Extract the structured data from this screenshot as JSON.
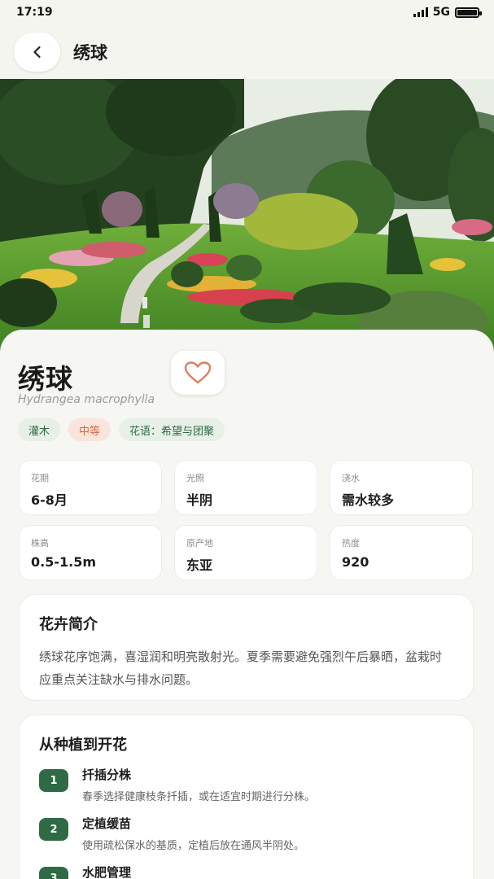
{
  "status_bar": {
    "time": "17:19",
    "network": "5G"
  },
  "nav": {
    "title": "绣球"
  },
  "plant": {
    "name": "绣球",
    "latin": "Hydrangea macrophylla",
    "tags": [
      {
        "label": "灌木",
        "style": "green"
      },
      {
        "label": "中等",
        "style": "orange"
      },
      {
        "label": "花语：希望与团聚",
        "style": "green"
      }
    ],
    "stats": [
      {
        "label": "花期",
        "value": "6-8月"
      },
      {
        "label": "光照",
        "value": "半阴"
      },
      {
        "label": "浇水",
        "value": "需水较多"
      },
      {
        "label": "株高",
        "value": "0.5-1.5m"
      },
      {
        "label": "原产地",
        "value": "东亚"
      },
      {
        "label": "热度",
        "value": "920"
      }
    ]
  },
  "intro": {
    "title": "花卉简介",
    "text": "绣球花序饱满，喜湿润和明亮散射光。夏季需要避免强烈午后暴晒，盆栽时应重点关注缺水与排水问题。"
  },
  "steps": {
    "title": "从种植到开花",
    "items": [
      {
        "num": "1",
        "title": "扦插分株",
        "desc": "春季选择健康枝条扦插，或在适宜时期进行分株。"
      },
      {
        "num": "2",
        "title": "定植缓苗",
        "desc": "使用疏松保水的基质，定植后放在通风半阴处。"
      },
      {
        "num": "3",
        "title": "水肥管理",
        "desc": ""
      }
    ]
  },
  "colors": {
    "accent": "#2e6b45",
    "heart": "#d9805c",
    "tag_orange": "#d06a45"
  },
  "icons": {
    "back": "chevron-left-icon",
    "favorite": "heart-outline-icon"
  }
}
